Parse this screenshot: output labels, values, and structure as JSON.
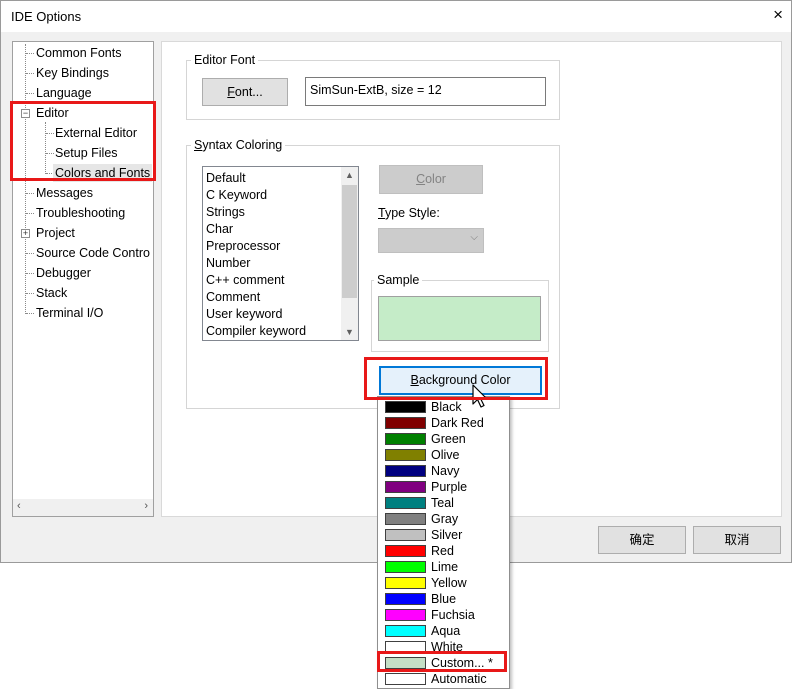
{
  "window": {
    "title": "IDE Options",
    "close_glyph": "×"
  },
  "tree": {
    "items": [
      {
        "label": "Common Fonts"
      },
      {
        "label": "Key Bindings"
      },
      {
        "label": "Language"
      },
      {
        "label": "Editor",
        "expander": "−"
      },
      {
        "label": "External Editor"
      },
      {
        "label": "Setup Files"
      },
      {
        "label": "Colors and Fonts"
      },
      {
        "label": "Messages"
      },
      {
        "label": "Troubleshooting"
      },
      {
        "label": "Project",
        "expander": "+"
      },
      {
        "label": "Source Code Contro"
      },
      {
        "label": "Debugger"
      },
      {
        "label": "Stack"
      },
      {
        "label": "Terminal I/O"
      }
    ],
    "scroll_left": "‹",
    "scroll_right": "›"
  },
  "editor_font": {
    "group_label": "Editor Font",
    "font_button": {
      "underlined": "F",
      "rest": "ont..."
    },
    "font_value": "SimSun-ExtB, size = 12"
  },
  "syntax": {
    "group_label_underlined": "S",
    "group_label_rest": "yntax Coloring",
    "list_items": [
      "Default",
      "C Keyword",
      "Strings",
      "Char",
      "Preprocessor",
      "Number",
      "C++ comment",
      "Comment",
      "User keyword",
      "Compiler keyword"
    ],
    "scroll_up": "▲",
    "scroll_down": "▼",
    "color_button": {
      "underlined": "C",
      "rest": "olor"
    },
    "type_style_label_underlined": "T",
    "type_style_label_rest": "ype Style:",
    "sample_label": "Sample",
    "sample_color": "#c5ecc8",
    "background_button": {
      "underlined": "B",
      "rest": "ackground Color"
    }
  },
  "color_menu": [
    {
      "label": "Black",
      "color": "#000000"
    },
    {
      "label": "Dark Red",
      "color": "#800000"
    },
    {
      "label": "Green",
      "color": "#008000"
    },
    {
      "label": "Olive",
      "color": "#808000"
    },
    {
      "label": "Navy",
      "color": "#000080"
    },
    {
      "label": "Purple",
      "color": "#800080"
    },
    {
      "label": "Teal",
      "color": "#008080"
    },
    {
      "label": "Gray",
      "color": "#808080"
    },
    {
      "label": "Silver",
      "color": "#c0c0c0"
    },
    {
      "label": "Red",
      "color": "#ff0000"
    },
    {
      "label": "Lime",
      "color": "#00ff00"
    },
    {
      "label": "Yellow",
      "color": "#ffff00"
    },
    {
      "label": "Blue",
      "color": "#0000ff"
    },
    {
      "label": "Fuchsia",
      "color": "#ff00ff"
    },
    {
      "label": "Aqua",
      "color": "#00ffff"
    },
    {
      "label": "White",
      "color": "#ffffff"
    },
    {
      "label": "Custom... *",
      "color": "#c5dfc6"
    },
    {
      "label": "Automatic",
      "color": "#ffffff"
    }
  ],
  "footer": {
    "ok_label": "确定",
    "cancel_label": "取消"
  },
  "highlight_color": "#e81818",
  "focus_color": "#0078d7"
}
